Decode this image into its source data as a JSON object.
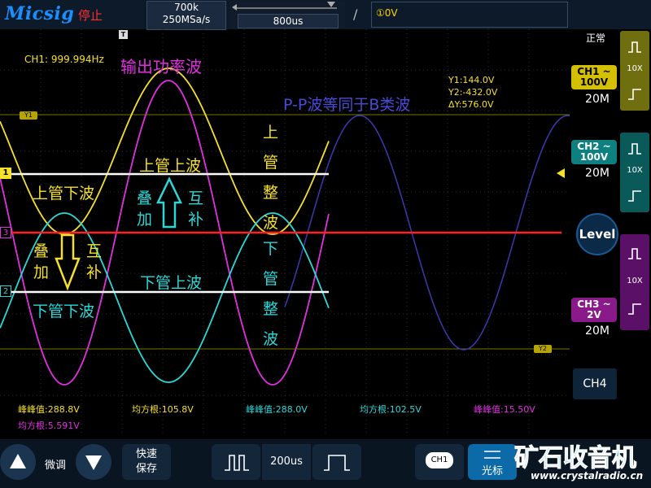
{
  "topbar": {
    "brand": "Micsig",
    "run_state": "停止",
    "memory_depth": "700k",
    "sample_rate": "250MSa/s",
    "timebase": "800us",
    "trigger_text": "①0V"
  },
  "panel": {
    "trigger_mode": "正常",
    "ch1": {
      "name": "CH1 ~",
      "volts": "100V",
      "bw": "20M",
      "probe": "10X"
    },
    "ch2": {
      "name": "CH2 ~",
      "volts": "100V",
      "bw": "20M",
      "probe": "10X"
    },
    "ch3": {
      "name": "CH3 ~",
      "volts": "2V",
      "bw": "20M",
      "probe": "10X"
    },
    "level_label": "Level",
    "ch4_label": "CH4"
  },
  "screen": {
    "freq": "CH1: 999.994Hz",
    "title_power": "输出功率波",
    "title_pp": "P-P波等同于B类波",
    "cursor_y1": "Y1:144.0V",
    "cursor_y2": "Y2:-432.0V",
    "cursor_dy": "ΔY:576.0V",
    "marker_y1": "Y1",
    "marker_y2": "Y2",
    "marker_1": "1",
    "marker_2": "2",
    "marker_3": "3",
    "marker_t": "T",
    "upper_top_wave": "上管上波",
    "upper_bottom_wave": "上管下波",
    "lower_top_wave": "下管上波",
    "lower_bottom_wave": "下管下波",
    "stack1_a": "叠",
    "stack1_b": "加",
    "comp1_a": "互",
    "comp1_b": "补",
    "stack2_a": "叠",
    "stack2_b": "加",
    "comp2_a": "互",
    "comp2_b": "补",
    "v_upper": [
      "上",
      "管",
      "整",
      "波"
    ],
    "v_lower": [
      "下",
      "管",
      "整",
      "波"
    ]
  },
  "measurements": {
    "m1": "峰峰值:288.8V",
    "m2": "均方根:105.8V",
    "m3": "峰峰值:288.0V",
    "m4": "均方根:102.5V",
    "m5": "峰峰值:15.50V",
    "m6": "均方根:5.591V"
  },
  "bottom": {
    "fine_label": "微调",
    "save_label": "快速\n保存",
    "timebase_btn": "200us",
    "ch1_icon": "CH1",
    "cursor_label": "光标",
    "watermark": "矿石收音机",
    "watermark_url": "www.crystalradio.cn"
  },
  "colors": {
    "ch1": "#f5e02a",
    "ch2": "#2ad8d8",
    "ch3": "#e030e0",
    "math": "#3a3ab0",
    "accent": "#1a8fff"
  }
}
